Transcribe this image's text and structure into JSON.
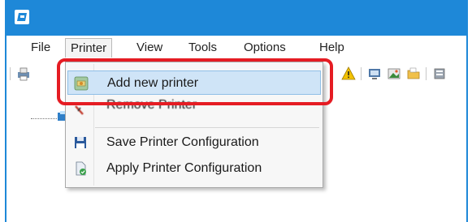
{
  "menubar": {
    "items": [
      "File",
      "Printer",
      "View",
      "Tools",
      "Options",
      "Help"
    ]
  },
  "dropdown": {
    "items": [
      {
        "label": "Add new printer",
        "icon": "add-printer-icon",
        "state": "hover"
      },
      {
        "label": "Remove Printer",
        "icon": "remove-printer-icon",
        "state": "normal"
      },
      {
        "label": "Save Printer Configuration",
        "icon": "save-disk-icon",
        "state": "normal"
      },
      {
        "label": "Apply Printer Configuration",
        "icon": "apply-config-icon",
        "state": "normal"
      }
    ]
  },
  "colors": {
    "titlebar": "#1e88d8",
    "highlight": "#e51c23",
    "hover": "#cfe4f7"
  }
}
